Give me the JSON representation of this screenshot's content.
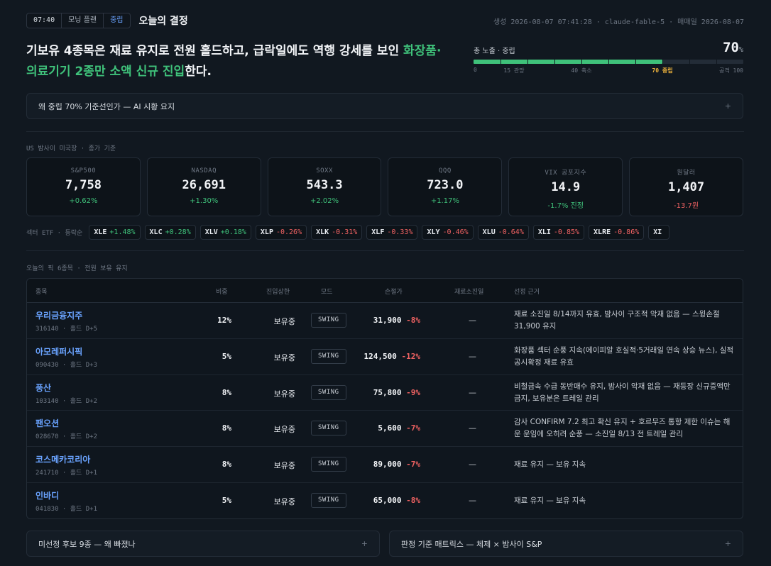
{
  "header": {
    "time": "07:40",
    "mode": "모닝 플랜",
    "stance": "중립",
    "title": "오늘의 결정",
    "meta": "생성 2026-08-07 07:41:28 · claude-fable-5 · 매매일 2026-08-07"
  },
  "headline": {
    "text_main": "기보유 4종목은 재료 유지로 전원 홀드하고, 급락일에도 역행 강세를 보인 ",
    "text_highlight": "화장품·의료기기 2종만 소액 신규 진입",
    "text_end": "한다."
  },
  "exposure": {
    "label": "총 노출 · 중립",
    "value": "70",
    "unit": "%",
    "level": 70,
    "fill_color": "#3fc17a",
    "scale": [
      {
        "label": "0",
        "at": 0
      },
      {
        "label": "15 관망",
        "at": 15
      },
      {
        "label": "40 축소",
        "at": 40
      },
      {
        "label": "70 중립",
        "at": 70,
        "active": true
      },
      {
        "label": "공격 100",
        "at": 100
      }
    ]
  },
  "why_section": {
    "label": "왜 중립 70% 기준선인가 — AI 시황 요지",
    "toggle": "+"
  },
  "us_section": {
    "label": "US 밤사이 미국장 · 종가 기준"
  },
  "indices": [
    {
      "name": "S&P500",
      "value": "7,758",
      "change": "+0.62%",
      "dir": "pos"
    },
    {
      "name": "NASDAQ",
      "value": "26,691",
      "change": "+1.30%",
      "dir": "pos"
    },
    {
      "name": "SOXX",
      "value": "543.3",
      "change": "+2.02%",
      "dir": "pos"
    },
    {
      "name": "QQQ",
      "value": "723.0",
      "change": "+1.17%",
      "dir": "pos"
    },
    {
      "name": "VIX 공포지수",
      "value": "14.9",
      "change": "-1.7% 진정",
      "dir": "pos"
    },
    {
      "name": "원달러",
      "value": "1,407",
      "change": "-13.7원",
      "dir": "neg"
    }
  ],
  "sectors": {
    "label": "섹터 ETF · 등락순",
    "items": [
      {
        "ticker": "XLE",
        "change": "+1.48%",
        "dir": "pos"
      },
      {
        "ticker": "XLC",
        "change": "+0.28%",
        "dir": "pos"
      },
      {
        "ticker": "XLV",
        "change": "+0.18%",
        "dir": "pos"
      },
      {
        "ticker": "XLP",
        "change": "-0.26%",
        "dir": "neg"
      },
      {
        "ticker": "XLK",
        "change": "-0.31%",
        "dir": "neg"
      },
      {
        "ticker": "XLF",
        "change": "-0.33%",
        "dir": "neg"
      },
      {
        "ticker": "XLY",
        "change": "-0.46%",
        "dir": "neg"
      },
      {
        "ticker": "XLU",
        "change": "-0.64%",
        "dir": "neg"
      },
      {
        "ticker": "XLI",
        "change": "-0.85%",
        "dir": "neg"
      },
      {
        "ticker": "XLRE",
        "change": "-0.86%",
        "dir": "neg"
      },
      {
        "ticker": "XI",
        "change": "",
        "dir": "neg"
      }
    ]
  },
  "picks": {
    "label": "오늘의 픽 6종목 · 전원 보유 유지",
    "columns": {
      "name": "종목",
      "weight": "비중",
      "entry_cap": "진입상한",
      "mode": "모드",
      "stop": "손절가",
      "expiry": "재료소진일",
      "reason": "선정 근거"
    },
    "rows": [
      {
        "name": "우리금융지주",
        "sub": "316140 · 홀드 D+5",
        "weight": "12%",
        "cap": "보유중",
        "mode": "SWING",
        "stop": "31,900",
        "stop_pct": "-8%",
        "expiry": "—",
        "reason": "재료 소진일 8/14까지 유효, 밤사이 구조적 악재 없음 — 스윙손절 31,900 유지"
      },
      {
        "name": "아모레퍼시픽",
        "sub": "090430 · 홀드 D+3",
        "weight": "5%",
        "cap": "보유중",
        "mode": "SWING",
        "stop": "124,500",
        "stop_pct": "-12%",
        "expiry": "—",
        "reason": "화장품 섹터 순풍 지속(에이피알 호실적·5거래일 연속 상승 뉴스), 실적 공시확정 재료 유효"
      },
      {
        "name": "풍산",
        "sub": "103140 · 홀드 D+2",
        "weight": "8%",
        "cap": "보유중",
        "mode": "SWING",
        "stop": "75,800",
        "stop_pct": "-9%",
        "expiry": "—",
        "reason": "비철금속 수급 동반매수 유지, 밤사이 악재 없음 — 재등장 신규증액만 금지, 보유분은 트레일 관리"
      },
      {
        "name": "팬오션",
        "sub": "028670 · 홀드 D+2",
        "weight": "8%",
        "cap": "보유중",
        "mode": "SWING",
        "stop": "5,600",
        "stop_pct": "-7%",
        "expiry": "—",
        "reason": "감사 CONFIRM 7.2 최고 확신 유지 + 호르무즈 통항 제한 이슈는 해운 운임에 오히려 순풍 — 소진일 8/13 전 트레일 관리"
      },
      {
        "name": "코스메카코리아",
        "sub": "241710 · 홀드 D+1",
        "weight": "8%",
        "cap": "보유중",
        "mode": "SWING",
        "stop": "89,000",
        "stop_pct": "-7%",
        "expiry": "—",
        "reason": "재료 유지 — 보유 지속"
      },
      {
        "name": "인바디",
        "sub": "041830 · 홀드 D+1",
        "weight": "5%",
        "cap": "보유중",
        "mode": "SWING",
        "stop": "65,000",
        "stop_pct": "-8%",
        "expiry": "—",
        "reason": "재료 유지 — 보유 지속"
      }
    ]
  },
  "bottom": {
    "left": {
      "label": "미선정 후보 9종 — 왜 빠졌나",
      "toggle": "+"
    },
    "right": {
      "label": "판정 기준 매트릭스 — 체제 × 밤사이 S&P",
      "toggle": "+"
    }
  }
}
